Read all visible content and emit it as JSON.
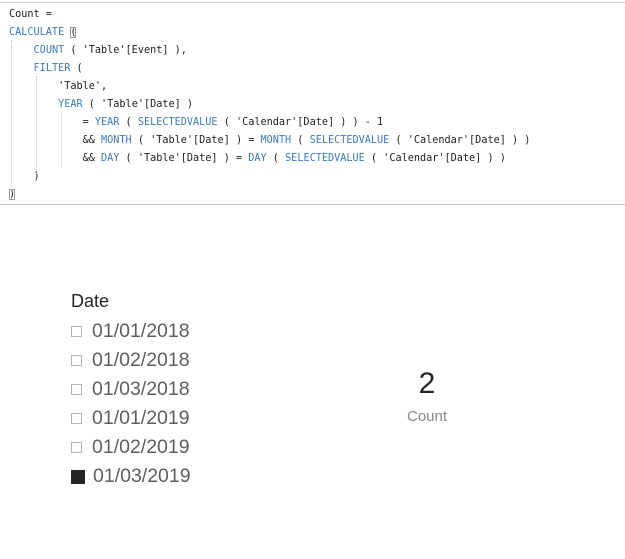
{
  "editor": {
    "lines": [
      [
        {
          "t": "Count ="
        }
      ],
      [
        {
          "t": "CALCULATE",
          "c": "kw"
        },
        {
          "t": " "
        },
        {
          "t": "(",
          "hl": true
        }
      ],
      [
        {
          "t": "    "
        },
        {
          "t": "COUNT",
          "c": "kw"
        },
        {
          "t": " ( 'Table'[Event] ),"
        }
      ],
      [
        {
          "t": "    "
        },
        {
          "t": "FILTER",
          "c": "kw"
        },
        {
          "t": " ("
        }
      ],
      [
        {
          "t": "        'Table',"
        }
      ],
      [
        {
          "t": "        "
        },
        {
          "t": "YEAR",
          "c": "kw"
        },
        {
          "t": " ( 'Table'[Date] )"
        }
      ],
      [
        {
          "t": "            = "
        },
        {
          "t": "YEAR",
          "c": "kw"
        },
        {
          "t": " ( "
        },
        {
          "t": "SELECTEDVALUE",
          "c": "kw"
        },
        {
          "t": " ( 'Calendar'[Date] ) ) - 1"
        }
      ],
      [
        {
          "t": "            && "
        },
        {
          "t": "MONTH",
          "c": "kw"
        },
        {
          "t": " ( 'Table'[Date] ) = "
        },
        {
          "t": "MONTH",
          "c": "kw"
        },
        {
          "t": " ( "
        },
        {
          "t": "SELECTEDVALUE",
          "c": "kw"
        },
        {
          "t": " ( 'Calendar'[Date] ) )"
        }
      ],
      [
        {
          "t": "            && "
        },
        {
          "t": "DAY",
          "c": "kw"
        },
        {
          "t": " ( 'Table'[Date] ) = "
        },
        {
          "t": "DAY",
          "c": "kw"
        },
        {
          "t": " ( "
        },
        {
          "t": "SELECTEDVALUE",
          "c": "kw"
        },
        {
          "t": " ( 'Calendar'[Date] ) )"
        }
      ],
      [
        {
          "t": "    )"
        }
      ],
      [
        {
          "t": ")",
          "hl": true
        }
      ]
    ]
  },
  "slicer": {
    "title": "Date",
    "items": [
      {
        "label": "01/01/2018",
        "checked": false
      },
      {
        "label": "01/02/2018",
        "checked": false
      },
      {
        "label": "01/03/2018",
        "checked": false
      },
      {
        "label": "01/01/2019",
        "checked": false
      },
      {
        "label": "01/02/2019",
        "checked": false
      },
      {
        "label": "01/03/2019",
        "checked": true
      }
    ]
  },
  "card": {
    "value": "2",
    "label": "Count"
  }
}
